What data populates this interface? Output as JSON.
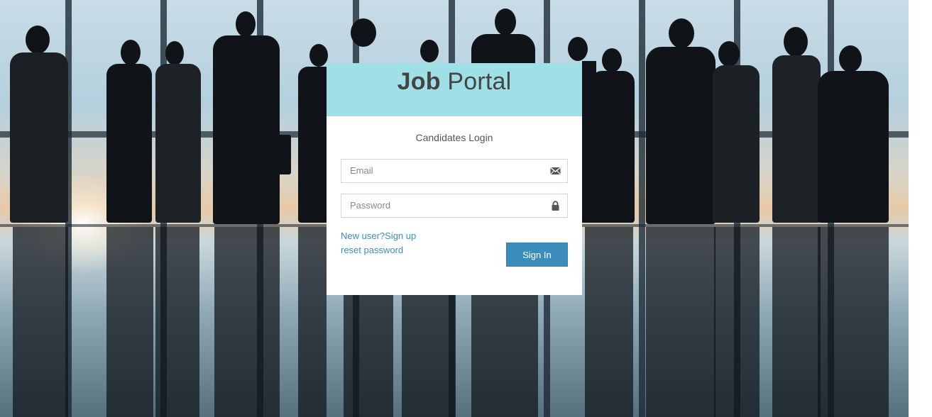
{
  "brand": {
    "bold": "Job",
    "light": "Portal"
  },
  "login": {
    "subtitle": "Candidates Login",
    "email_placeholder": "Email",
    "password_placeholder": "Password",
    "signup_link": "New user?Sign up",
    "reset_link": "reset password",
    "signin_label": "Sign In"
  },
  "icons": {
    "email": "envelope-icon",
    "password": "lock-icon"
  },
  "colors": {
    "header_bg": "#9fe0e6",
    "primary": "#3c8dbc",
    "link": "#3c8dbc",
    "logo_text": "#444444"
  }
}
